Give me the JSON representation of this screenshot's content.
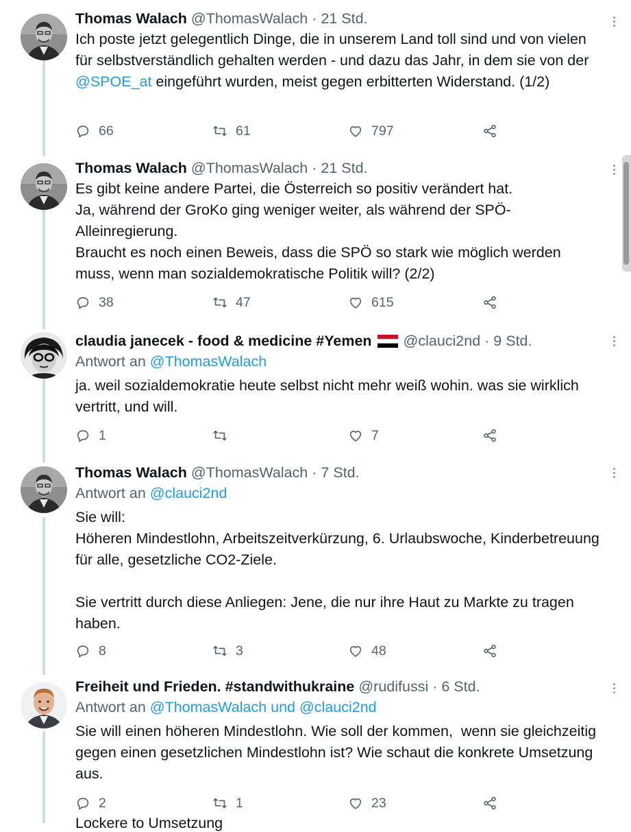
{
  "tweets": [
    {
      "name": "Thomas Walach",
      "handle": "@ThomasWalach",
      "time": "· 21 Std.",
      "body_pre": "Ich poste jetzt gelegentlich Dinge, die in unserem Land toll sind und von vielen für selbstverständlich gehalten werden - und dazu das Jahr, in dem sie von der ",
      "body_mention": "@SPOE_at",
      "body_post": " eingeführt wurden, meist gegen erbitterten Widerstand. (1/2)",
      "replies": "66",
      "retweets": "61",
      "likes": "797"
    },
    {
      "name": "Thomas Walach",
      "handle": "@ThomasWalach",
      "time": "· 21 Std.",
      "body": "Es gibt keine andere Partei, die Österreich so positiv verändert hat.\nJa, während der GroKo ging weniger weiter, als während der SPÖ-Alleinregierung.\nBraucht es noch einen Beweis, dass die SPÖ so stark wie möglich werden muss, wenn man sozialdemokratische Politik will? (2/2)",
      "replies": "38",
      "retweets": "47",
      "likes": "615"
    },
    {
      "name": "claudia janecek - food & medicine #Yemen",
      "handle": "@clauci2nd",
      "time": "· 9 Std.",
      "reply_label": "Antwort an",
      "reply_to": "@ThomasWalach",
      "body": "ja. weil sozialdemokratie heute selbst nicht mehr weiß wohin. was sie wirklich vertritt, und will.",
      "replies": "1",
      "retweets": "",
      "likes": "7"
    },
    {
      "name": "Thomas Walach",
      "handle": "@ThomasWalach",
      "time": "· 7 Std.",
      "reply_label": "Antwort an",
      "reply_to": "@clauci2nd",
      "body": "Sie will:\nHöheren Mindestlohn, Arbeitszeitverkürzung, 6. Urlaubswoche, Kinderbetreuung für alle, gesetzliche CO2-Ziele.\n\nSie vertritt durch diese Anliegen: Jene, die nur ihre Haut zu Markte zu tragen haben.",
      "replies": "8",
      "retweets": "3",
      "likes": "48"
    },
    {
      "name": "Freiheit und Frieden. #standwithukraine",
      "handle": "@rudifussi",
      "time": "· 6 Std.",
      "reply_label": "Antwort an",
      "reply_to": "@ThomasWalach und @clauci2nd",
      "body": "Sie will einen höheren Mindestlohn. Wie soll der kommen,  wenn sie gleichzeitig gegen einen gesetzlichen Mindestlohn ist? Wie schaut die konkrete Umsetzung aus.",
      "replies": "2",
      "retweets": "1",
      "likes": "23"
    }
  ],
  "partial_text": "Lockere to Umsetzung",
  "icons": {
    "reply": "reply-icon",
    "retweet": "retweet-icon",
    "like": "heart-icon",
    "share": "share-icon",
    "more": "more-icon",
    "flag": "yemen-flag-icon"
  },
  "colors": {
    "text": "#0f1419",
    "secondary": "#536471",
    "link": "#1d9bf0",
    "thread_line": "#cfd9de"
  }
}
